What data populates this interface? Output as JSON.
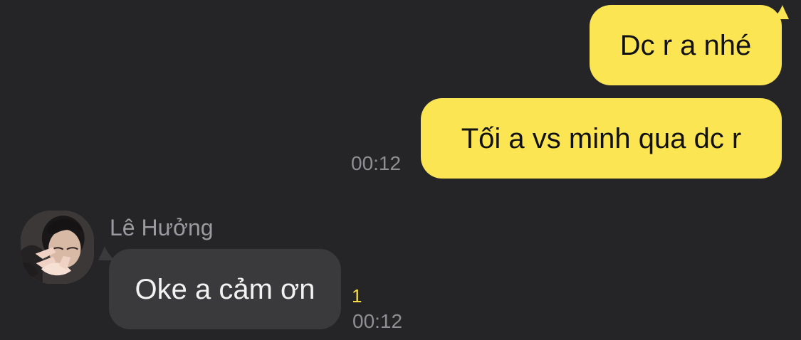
{
  "messages": {
    "outgoing": [
      {
        "text": "Dc r a nhé"
      },
      {
        "text": "Tối a vs minh qua dc r",
        "time": "00:12"
      }
    ],
    "incoming": {
      "sender": "Lê Hưởng",
      "text": "Oke a cảm ơn",
      "time": "00:12",
      "unread_count": "1"
    }
  },
  "colors": {
    "background": "#252527",
    "outgoing_bubble": "#fbe553",
    "incoming_bubble": "#3a3a3c",
    "timestamp": "#8e8e93",
    "unread": "#f5df46"
  },
  "icons": {
    "avatar": "profile-photo"
  }
}
